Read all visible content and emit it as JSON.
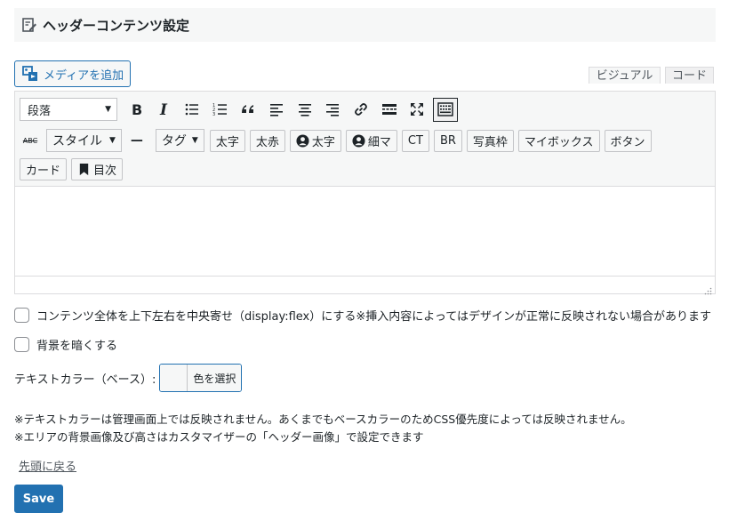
{
  "section": {
    "title": "ヘッダーコンテンツ設定",
    "icon": "edit-note-icon"
  },
  "media_button": {
    "label": "メディアを追加",
    "icon": "add-media-icon"
  },
  "tabs": {
    "visual": "ビジュアル",
    "code": "コード"
  },
  "toolbar": {
    "format_select": "段落",
    "row1_icons": [
      "bold-icon",
      "italic-icon",
      "bullet-list-icon",
      "numbered-list-icon",
      "blockquote-icon",
      "align-left-icon",
      "align-center-icon",
      "align-right-icon",
      "link-icon",
      "read-more-icon",
      "fullscreen-icon",
      "toolbar-toggle-icon"
    ],
    "strike_icon_text": "ABC",
    "style_dropdown": "スタイル",
    "hr_symbol": "—",
    "tag_dropdown": "タグ",
    "buttons": {
      "bold_text": "太字",
      "bold_red": "太赤",
      "user_bold": "太字",
      "user_thin": "細マ",
      "ct": "CT",
      "br": "BR",
      "photo_frame": "写真枠",
      "my_box": "マイボックス",
      "button": "ボタン",
      "card": "カード",
      "toc": "目次"
    }
  },
  "options": {
    "flex_center": "コンテンツ全体を上下左右を中央寄せ（display:flex）にする※挿入内容によってはデザインが正常に反映されない場合があります",
    "darken_bg": "背景を暗くする"
  },
  "text_color": {
    "label": "テキストカラー（ベース）:",
    "button": "色を選択"
  },
  "notes": {
    "note1": "※テキストカラーは管理画面上では反映されません。あくまでもベースカラーのためCSS優先度によっては反映されません。",
    "note2": "※エリアの背景画像及び高さはカスタマイザーの「ヘッダー画像」で設定できます"
  },
  "back_to_top": "先頭に戻る",
  "save": "Save",
  "colors": {
    "accent": "#2271b1",
    "panel": "#f6f7f7",
    "border": "#dcdcde"
  }
}
